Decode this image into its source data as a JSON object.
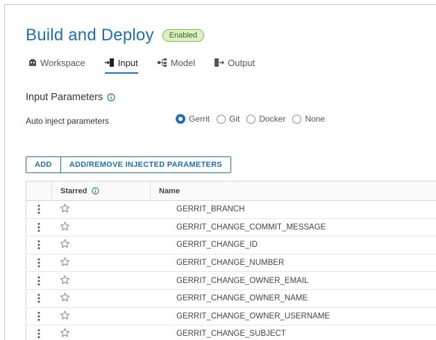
{
  "header": {
    "title": "Build and Deploy",
    "status_badge": "Enabled"
  },
  "tabs": [
    {
      "label": "Workspace",
      "icon": "workspace-icon",
      "active": false
    },
    {
      "label": "Input",
      "icon": "input-icon",
      "active": true
    },
    {
      "label": "Model",
      "icon": "model-icon",
      "active": false
    },
    {
      "label": "Output",
      "icon": "output-icon",
      "active": false
    }
  ],
  "input_section": {
    "title": "Input Parameters",
    "auto_inject_label": "Auto inject parameters",
    "options": [
      {
        "label": "Gerrit",
        "selected": true
      },
      {
        "label": "Git",
        "selected": false
      },
      {
        "label": "Docker",
        "selected": false
      },
      {
        "label": "None",
        "selected": false
      }
    ]
  },
  "buttons": {
    "add": "ADD",
    "add_remove": "ADD/REMOVE INJECTED PARAMETERS"
  },
  "table": {
    "columns": [
      "Starred",
      "Name"
    ],
    "rows": [
      {
        "name": "GERRIT_BRANCH",
        "starred": false
      },
      {
        "name": "GERRIT_CHANGE_COMMIT_MESSAGE",
        "starred": false
      },
      {
        "name": "GERRIT_CHANGE_ID",
        "starred": false
      },
      {
        "name": "GERRIT_CHANGE_NUMBER",
        "starred": false
      },
      {
        "name": "GERRIT_CHANGE_OWNER_EMAIL",
        "starred": false
      },
      {
        "name": "GERRIT_CHANGE_OWNER_NAME",
        "starred": false
      },
      {
        "name": "GERRIT_CHANGE_OWNER_USERNAME",
        "starred": false
      },
      {
        "name": "GERRIT_CHANGE_SUBJECT",
        "starred": false
      }
    ]
  },
  "colors": {
    "accent": "#1f6fb2",
    "badge_bg": "#dff0c8",
    "badge_border": "#7fbf3a"
  }
}
